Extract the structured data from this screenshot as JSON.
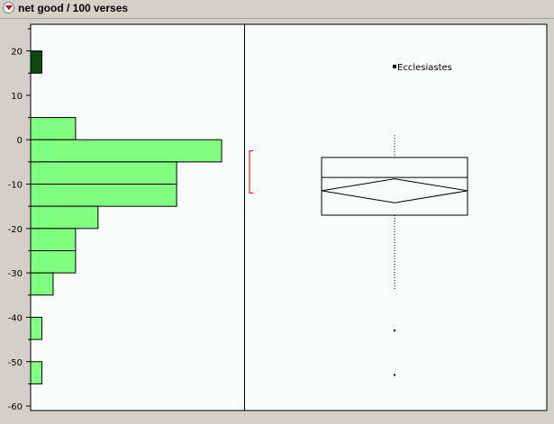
{
  "window": {
    "title": "net good / 100 verses"
  },
  "chart_data": {
    "type": "histogram-boxplot",
    "ylim": [
      -61,
      26
    ],
    "yticks": [
      20,
      10,
      0,
      -10,
      -20,
      -30,
      -40,
      -50,
      -60
    ],
    "histogram": {
      "bin_width": 5,
      "bins": [
        {
          "from": 15,
          "to": 20,
          "count": 1,
          "selected": true
        },
        {
          "from": 0,
          "to": 5,
          "count": 4,
          "selected": false
        },
        {
          "from": -5,
          "to": 0,
          "count": 17,
          "selected": false
        },
        {
          "from": -10,
          "to": -5,
          "count": 13,
          "selected": false
        },
        {
          "from": -15,
          "to": -10,
          "count": 13,
          "selected": false
        },
        {
          "from": -20,
          "to": -15,
          "count": 6,
          "selected": false
        },
        {
          "from": -25,
          "to": -20,
          "count": 4,
          "selected": false
        },
        {
          "from": -30,
          "to": -25,
          "count": 4,
          "selected": false
        },
        {
          "from": -35,
          "to": -30,
          "count": 2,
          "selected": false
        },
        {
          "from": -45,
          "to": -40,
          "count": 1,
          "selected": false
        },
        {
          "from": -55,
          "to": -50,
          "count": 1,
          "selected": false
        }
      ],
      "max_count": 18
    },
    "boxplot": {
      "q1": -17,
      "median": -8.5,
      "q3": -4,
      "whisker_low": -34,
      "whisker_high": 1,
      "mean": -11.5,
      "mean_ci": [
        -14.2,
        -8.8
      ],
      "shortest_half": [
        -12,
        -2.5
      ],
      "outliers": [
        {
          "value": 16.5,
          "label": "Ecclesiastes"
        },
        {
          "value": -43,
          "label": ""
        },
        {
          "value": -53,
          "label": ""
        }
      ]
    },
    "colors": {
      "bar": "#80ff80",
      "bar_selected": "#0a4a0a",
      "plot_bg": "#f8fcfa",
      "bracket": "#cc0000"
    }
  }
}
